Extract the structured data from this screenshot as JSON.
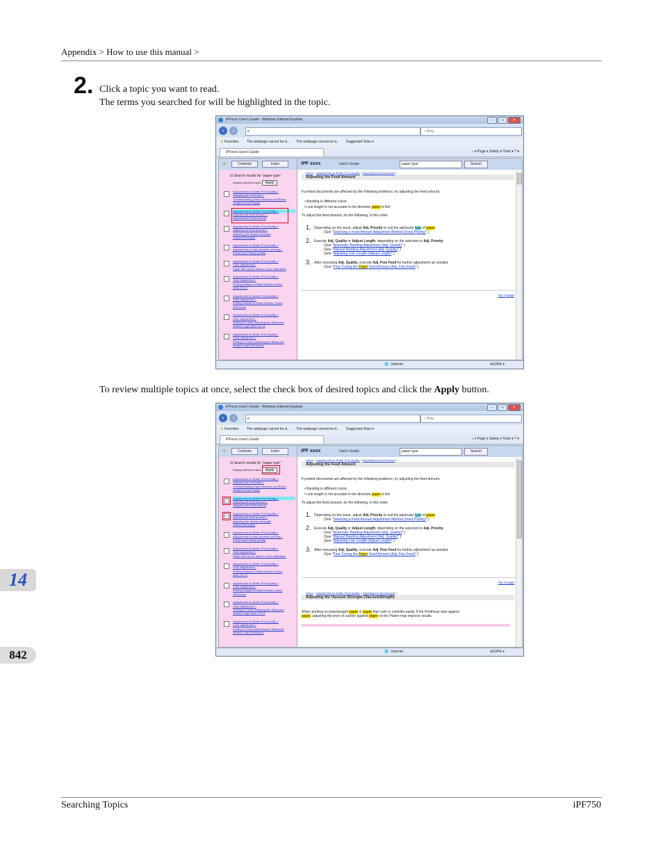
{
  "header": {
    "breadcrumb": "Appendix > How to use this manual >"
  },
  "step": {
    "number": "2.",
    "line1": "Click a topic you want to read.",
    "line2": "The terms you searched for will be highlighted in the topic."
  },
  "para2": {
    "prefix": "To review multiple topics at once, select the check box of desired topics and click the ",
    "bold": "Apply",
    "suffix": " button."
  },
  "side": {
    "chapter": "14",
    "page": "842"
  },
  "footer": {
    "left": "Searching Topics",
    "right": "iPF750"
  },
  "browser": {
    "window_title": "iPFxxxx  User's Guide - Windows Internet Explorer",
    "win_buttons": [
      "–",
      "▭",
      "✕"
    ],
    "address": "e",
    "bing_placeholder": "Bing",
    "favorites_label": "Favorites",
    "fav_items": [
      "The webpage cannot be d...",
      "The webpage cannot be d...",
      "Suggested Sites ▾"
    ],
    "tab_label": "iPFxxxx  User's Guide",
    "cmd_items": "Page ▾   Safety ▾   Tools ▾",
    "contents_btn": "Contents",
    "index_btn": "Index",
    "brand": "iPF xxxx",
    "users_guide": "User's Guide",
    "search_value": "paper type",
    "search_btn": "Search",
    "results_title": "Search results for \"paper type\"",
    "display_selected": "Display selected topics",
    "apply": "Apply",
    "results": [
      [
        "Adjustments for Better Print Quality >",
        "Adjusting the Printhead >",
        "Troubleshooting Paper Abrasion and Blurry",
        "Images (Head Height)"
      ],
      [
        "Adjustments for Better Print Quality >",
        "Adjusting the feed amount >",
        "Adjusting the Feed Amount"
      ],
      [
        "Adjustments for Better Print Quality >",
        "Adjusting the feed amount >",
        "Adjusting the Vacuum Strength",
        "(VacuumStrength)"
      ],
      [
        "Adjustments for Better Print Quality >",
        "Adjustments for high-precision printing >",
        "Enhancing Printing Quality"
      ],
      [
        "Adjustments for Better Print Quality >",
        "Color adjustment >",
        "Paper that can be used in Color Calibration"
      ],
      [
        "Adjustments for Better Print Quality >",
        "Color adjustment >",
        "Printing Images to Match Monitor Colors",
        "(Mac OS X)"
      ],
      [
        "Adjustments for Better Print Quality >",
        "Color adjustment >",
        "Printing Images to Match Monitor Colors",
        "(Windows)"
      ],
      [
        "Adjustments for Better Print Quality >",
        "Color adjustment >",
        "Printing in Colors Matching the Measured",
        "Ambient Light (Mac OS X)"
      ],
      [
        "Adjustments for Better Print Quality >",
        "Color adjustment >",
        "Printing in Colors Matching the Measured",
        "Ambient Light (Windows)"
      ]
    ],
    "doc_bc": {
      "home": "Home",
      "sep": " > ",
      "l1": "Adjustments for Better Print Quality",
      "l2": "Adjusting the feed amount",
      "end": " >"
    },
    "doc_title": "Adjusting the Feed Amount",
    "intro": "If printed documents are affected by the following problems, try adjusting the feed amount.",
    "bullet1": "• Banding in different colors",
    "bullet2_a": "• Line length is not accurate in the direction ",
    "paper": "paper",
    "bullet2_b": " is fed",
    "todo": "To adjust the feed amount, do the following, in this order.",
    "s1_num": "1.",
    "s1_a": "Depending on the issue, adjust ",
    "s1_b": "Adj. Priority",
    "s1_c": " to suit the particular ",
    "type": "type",
    "s1_d": " of ",
    "s1_e": ".",
    "see_open": "(See \"",
    "see_close": "\".)",
    "s1_see": "Selecting a Feed Amount Adjustment Method (Feed Priority)",
    "s2_num": "2.",
    "s2_a": "Execute ",
    "s2_b": "Adj. Quality",
    "s2_c": " or ",
    "s2_d": "Adjust Length",
    "s2_e": ", depending on the selection in ",
    "s2_f": "Adj. Priority",
    "s2_g": ".",
    "s2_see1": "Automatic Banding Adjustment (Adj. Quality)",
    "s2_see2": "Manual Banding Adjustment (Adj. Quality)",
    "s2_see3": "Adjusting Line Length (Adjust Length)",
    "s3_num": "3.",
    "s3_a": "After executing ",
    "s3_b": "Adj. Quality",
    "s3_c": ", execute ",
    "s3_d": "Adj. Fine Feed",
    "s3_e": " for further adjustment as needed.",
    "s3_see_pre": "Fine-Tuning the ",
    "s3_see_paper": "Paper",
    "s3_see_post": " Feed Amount (Adj. Fine Feed)",
    "top_of_page": "Top of page",
    "sec2_title": "Adjusting the Vacuum Strength (VacuumStrngth)",
    "sec2_a": "When printing on heavyweight ",
    "sec2_b": " or ",
    "sec2_c": " that curls or wrinkles easily, if the Printhead rubs against",
    "sec2_d": ", adjusting the level of suction against ",
    "sec2_e": " on the Platen may improve results.",
    "status": "Internet",
    "zoom": "100%"
  }
}
